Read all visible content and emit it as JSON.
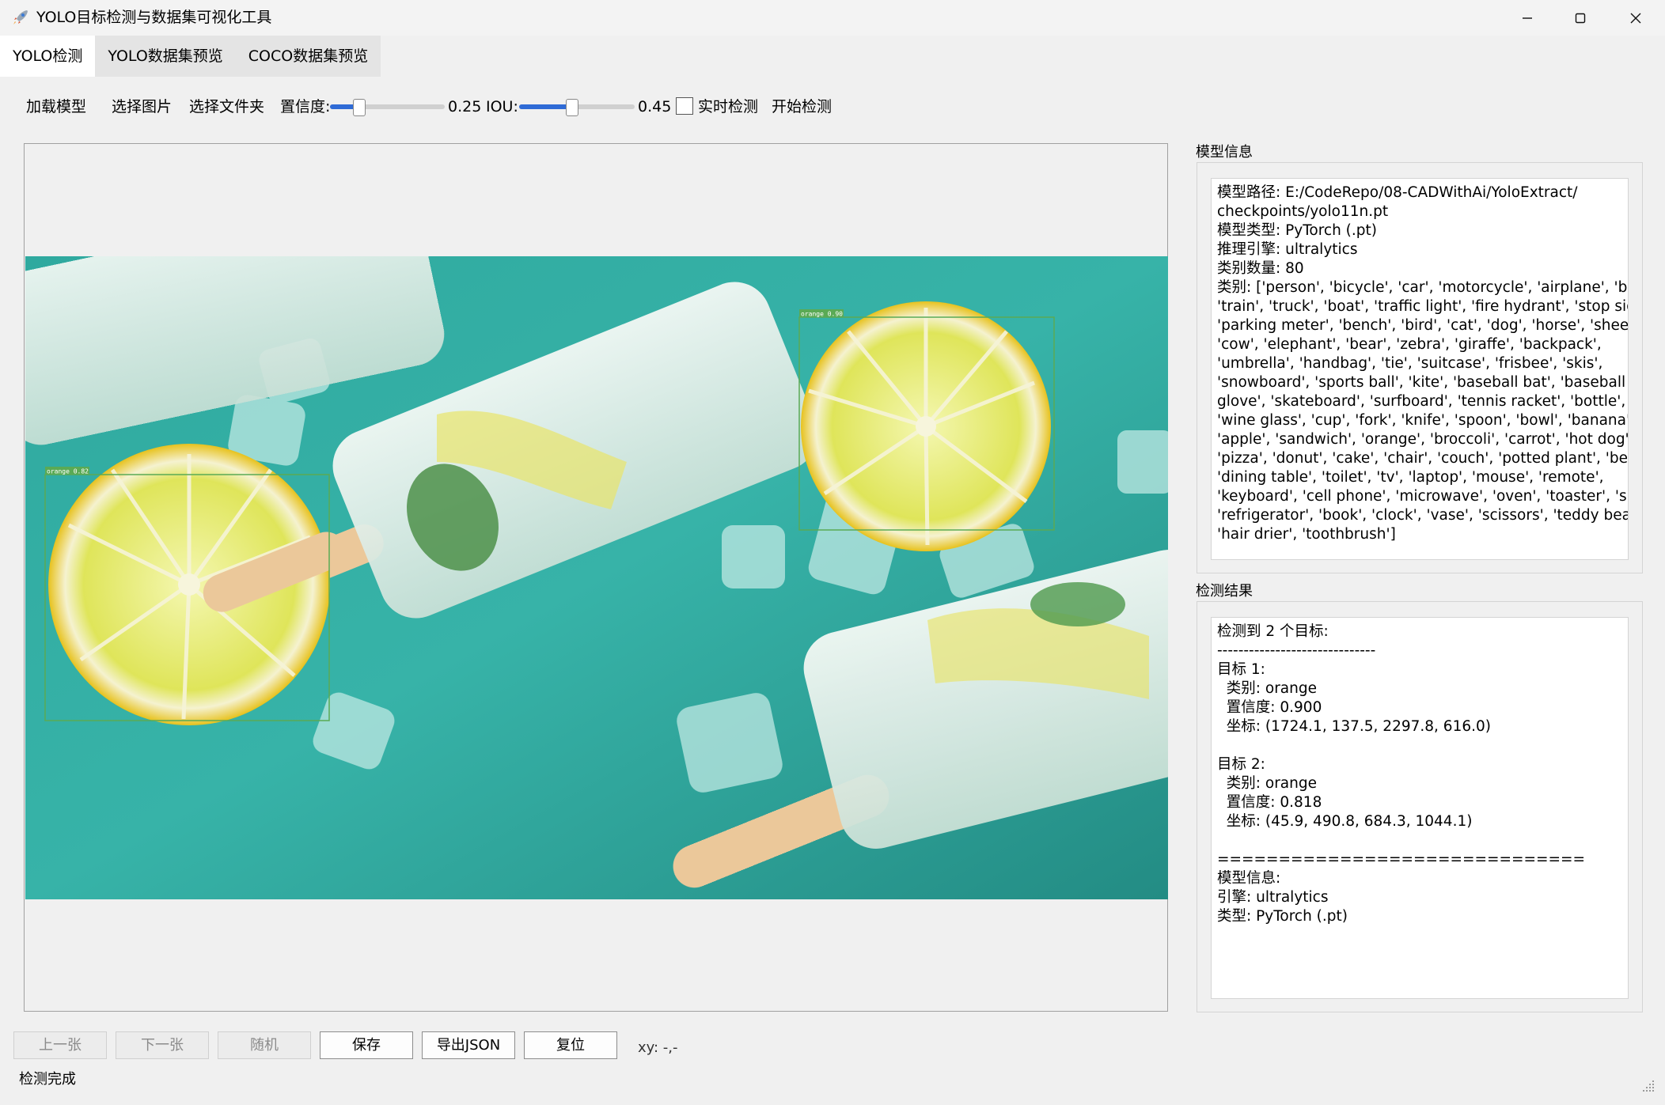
{
  "window": {
    "title": "YOLO目标检测与数据集可视化工具",
    "app_icon": "rocket-icon",
    "controls": [
      "minimize-icon",
      "maximize-icon",
      "close-icon"
    ]
  },
  "tabs": [
    {
      "label": "YOLO检测",
      "active": true
    },
    {
      "label": "YOLO数据集预览",
      "active": false
    },
    {
      "label": "COCO数据集预览",
      "active": false
    }
  ],
  "toolbar": {
    "load_model": "加载模型",
    "select_image": "选择图片",
    "select_folder": "选择文件夹",
    "confidence_label": "置信度:",
    "confidence_value": "0.25",
    "confidence_level": 0.25,
    "iou_label": "IOU:",
    "iou_value": "0.45",
    "iou_level": 0.45,
    "realtime_label": "实时检测",
    "realtime_checked": false,
    "start_detect": "开始检测"
  },
  "viewer": {
    "detections": [
      {
        "label": "orange 0.90"
      },
      {
        "label": "orange 0.82"
      }
    ]
  },
  "model_info": {
    "title": "模型信息",
    "lines": [
      "模型路径: E:/CodeRepo/08-CADWithAi/YoloExtract/",
      "checkpoints/yolo11n.pt",
      "模型类型: PyTorch (.pt)",
      "推理引擎: ultralytics",
      "类别数量: 80",
      "类别: ['person', 'bicycle', 'car', 'motorcycle', 'airplane', 'bus',",
      "'train', 'truck', 'boat', 'traffic light', 'fire hydrant', 'stop sign',",
      "'parking meter', 'bench', 'bird', 'cat', 'dog', 'horse', 'sheep',",
      "'cow', 'elephant', 'bear', 'zebra', 'giraffe', 'backpack',",
      "'umbrella', 'handbag', 'tie', 'suitcase', 'frisbee', 'skis',",
      "'snowboard', 'sports ball', 'kite', 'baseball bat', 'baseball",
      "glove', 'skateboard', 'surfboard', 'tennis racket', 'bottle',",
      "'wine glass', 'cup', 'fork', 'knife', 'spoon', 'bowl', 'banana',",
      "'apple', 'sandwich', 'orange', 'broccoli', 'carrot', 'hot dog',",
      "'pizza', 'donut', 'cake', 'chair', 'couch', 'potted plant', 'bed',",
      "'dining table', 'toilet', 'tv', 'laptop', 'mouse', 'remote',",
      "'keyboard', 'cell phone', 'microwave', 'oven', 'toaster', 'sink',",
      "'refrigerator', 'book', 'clock', 'vase', 'scissors', 'teddy bear',",
      "'hair drier', 'toothbrush']"
    ]
  },
  "results": {
    "title": "检测结果",
    "lines": [
      "检测到 2 个目标:",
      "------------------------------",
      "目标 1:",
      "  类别: orange",
      "  置信度: 0.900",
      "  坐标: (1724.1, 137.5, 2297.8, 616.0)",
      "",
      "目标 2:",
      "  类别: orange",
      "  置信度: 0.818",
      "  坐标: (45.9, 490.8, 684.3, 1044.1)",
      "",
      "==============================",
      "模型信息:",
      "引擎: ultralytics",
      "类型: PyTorch (.pt)"
    ]
  },
  "bottom": {
    "prev": "上一张",
    "next": "下一张",
    "random": "随机",
    "save": "保存",
    "export_json": "导出JSON",
    "reset": "复位",
    "xy_readout": "xy: -,-"
  },
  "status": "检测完成"
}
